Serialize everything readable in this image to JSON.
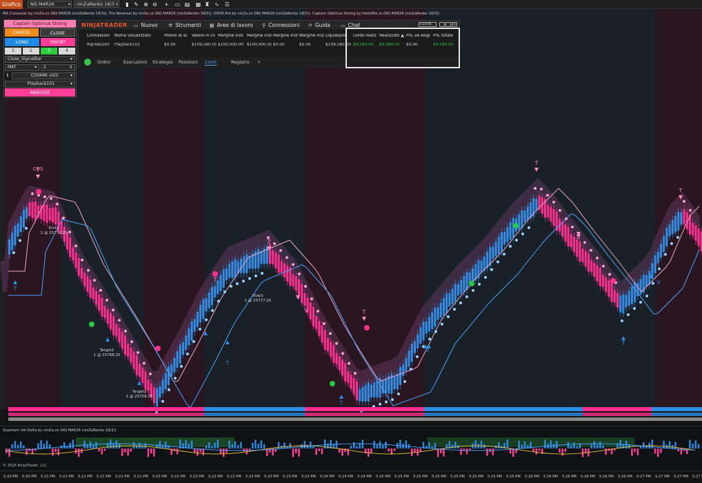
{
  "toolbar": {
    "tab": "Grafico",
    "instrument": "NQ MAR26",
    "bar_type": "ninZaRenko 18/3",
    "icons": [
      "bar-style-icon",
      "draw-icon",
      "zoom-in-icon",
      "zoom-out-icon",
      "crosshair-icon",
      "scroll-icon",
      "properties-icon",
      "template-icon",
      "strategy-icon",
      "indicator-icon",
      "list-icon"
    ]
  },
  "chart": {
    "indicator_title": "MA Crossover by ninZa.co (NQ MAR26 (ninZaRenko 18/3)), Trio Reversal by ninZa.co (NQ MAR26 (ninZaRenko 18/3)), VIDYA Pro by ninZa.co (NQ MAR26 (ninZaRenko 18/3)), Captain Optimus Strong by HelioWin.io (NQ MAR26 (ninZaRenko 18/3))",
    "labels": {
      "cos": "COS",
      "t": "T",
      "v": "V",
      "entry": "Entry",
      "entry_val": "1 @ 25779.25",
      "target1": "Target1",
      "target1_val": "1 @ 25768.25",
      "target2": "Target2",
      "target2_val": "1 @ 25758.25",
      "stop1": "Stop1",
      "stop1_val": "1 @ 25777.25"
    },
    "colors": {
      "bull": "#2e8fe6",
      "bear": "#ff2e8f",
      "bear_zone": "#2a1620",
      "bull_zone": "#1a2028",
      "green_dot": "#27c93f",
      "pink_dot": "#f4a6c6",
      "blue_dot": "#9ad0ff"
    }
  },
  "panel": {
    "title": "Captain Optimus Strong",
    "cancel": "CANCEL",
    "close": "CLOSE",
    "long": "LONG",
    "short": "SHORT",
    "nums": [
      "1",
      "2",
      "3",
      "4"
    ],
    "signal": "Close_SignalBar",
    "order_type": "MKT",
    "qty": "2",
    "atm": "COSMIK vid3",
    "account": "Playback101",
    "analyze": "ANALYZE"
  },
  "ninjatrader": {
    "logo": "NINJATRADER",
    "menu": [
      "Nuovo",
      "Strumenti",
      "Aree di lavoro",
      "Connessioni",
      "Guida",
      "Chat"
    ],
    "window_title": "Guarda",
    "headers": [
      "Connession",
      "Nome visualizzato",
      "Potere di ac",
      "Valore in co",
      "Margine inizi",
      "Margine inizi",
      "Margine inizi",
      "Margine inizi",
      "Liquidazio",
      "Lordo realiz",
      "Realizzato ▲",
      "PnL ad esigi",
      "PnL totale"
    ],
    "row": [
      "Riproduzior",
      "Playback101",
      "$0.00",
      "$109,580.00",
      "$100,000.00",
      "$100,000.00",
      "$0.00",
      "$0.00",
      "$109,580.00",
      "$9,580.00",
      "$9,580.00",
      "$0.00",
      "$9,580.00"
    ],
    "tabs": [
      "Ordini",
      "Esecuzioni",
      "Strategie",
      "Posizioni",
      "Conti",
      "Registro",
      "+"
    ]
  },
  "indicator2": {
    "title": "Quantum Vol-Delta by ninZa.co (NQ MAR26 (ninZaRenko 18/3))",
    "copyright": "© 2026 NinjaTrader, LLC"
  },
  "xaxis": {
    "ticks": [
      "5:20 PM",
      "5:20 PM",
      "5:21 PM",
      "5:21 PM",
      "5:21 PM",
      "5:21 PM",
      "5:21 PM",
      "5:21 PM",
      "5:22 PM",
      "5:22 PM",
      "5:22 PM",
      "5:22 PM",
      "5:22 PM",
      "5:23 PM",
      "5:23 PM",
      "5:23 PM",
      "5:23 PM",
      "5:24 PM",
      "5:24 PM",
      "5:24 PM",
      "5:25 PM",
      "5:25 PM",
      "5:25 PM",
      "5:25 PM",
      "5:25 PM",
      "5:25 PM",
      "5:25 PM",
      "5:25 PM",
      "5:26 PM",
      "5:26 PM",
      "5:26 PM",
      "5:26 PM",
      "5:26 PM",
      "5:26 PM",
      "5:27 PM",
      "5:27 PM",
      "5:27 PM",
      "5:27 PM"
    ]
  }
}
